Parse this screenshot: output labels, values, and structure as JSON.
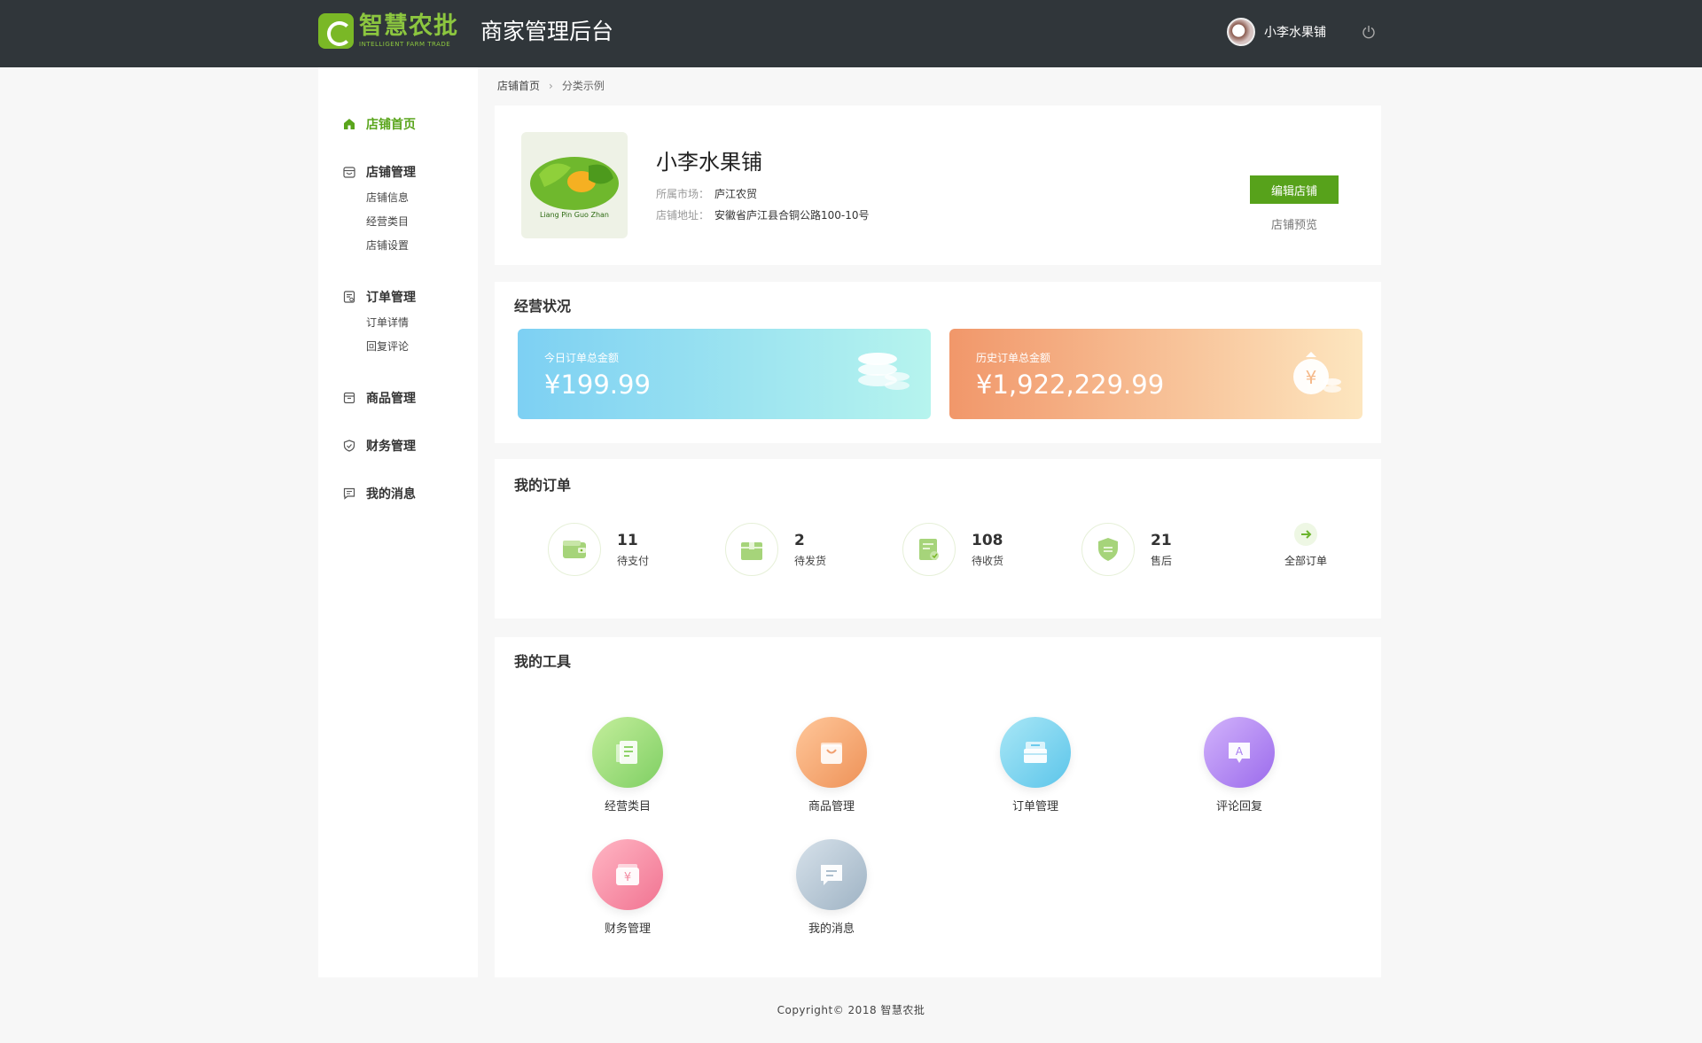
{
  "header": {
    "logo_title": "智慧农批",
    "logo_subtitle": "INTELLIGENT FARM TRADE",
    "app_title": "商家管理后台",
    "user_name": "小李水果铺"
  },
  "sidebar": {
    "home": "店铺首页",
    "store_mgmt": "店铺管理",
    "store_info": "店铺信息",
    "business_category": "经营类目",
    "store_settings": "店铺设置",
    "order_mgmt": "订单管理",
    "order_detail": "订单详情",
    "reply_comments": "回复评论",
    "goods_mgmt": "商品管理",
    "finance_mgmt": "财务管理",
    "my_messages": "我的消息"
  },
  "breadcrumb": {
    "home": "店铺首页",
    "current": "分类示例"
  },
  "store": {
    "name": "小李水果铺",
    "market_label": "所属市场：",
    "market": "庐江农贸",
    "address_label": "店铺地址：",
    "address": "安徽省庐江县合铜公路100-10号",
    "edit_button": "编辑店铺",
    "preview_link": "店铺预览",
    "logo_text": "Liang Pin Guo Zhan"
  },
  "status": {
    "title": "经营状况",
    "today_label": "今日订单总金额",
    "today_value": "¥199.99",
    "history_label": "历史订单总金额",
    "history_value": "¥1,922,229.99"
  },
  "orders": {
    "title": "我的订单",
    "items": [
      {
        "count": "11",
        "label": "待支付"
      },
      {
        "count": "2",
        "label": "待发货"
      },
      {
        "count": "108",
        "label": "待收货"
      },
      {
        "count": "21",
        "label": "售后"
      }
    ],
    "all_label": "全部订单"
  },
  "tools": {
    "title": "我的工具",
    "items": [
      {
        "label": "经营类目"
      },
      {
        "label": "商品管理"
      },
      {
        "label": "订单管理"
      },
      {
        "label": "评论回复"
      },
      {
        "label": "财务管理"
      },
      {
        "label": "我的消息"
      }
    ]
  },
  "footer": "Copyright© 2018 智慧农批",
  "colors": {
    "header_bg": "#30363a",
    "accent_green": "#57a21b",
    "active_nav": "#5aa51c"
  }
}
